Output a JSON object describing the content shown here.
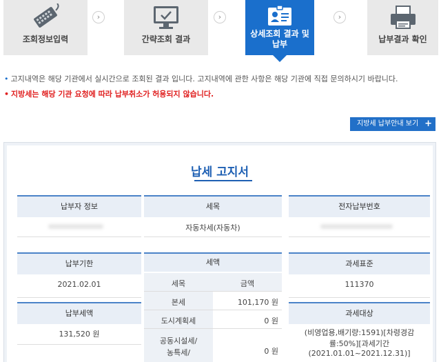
{
  "steps": [
    {
      "label": "조회정보입력",
      "icon": "keyboard-icon"
    },
    {
      "label": "간략조회 결과",
      "icon": "monitor-check-icon"
    },
    {
      "label": "상세조회 결과 및\n납부",
      "icon": "id-card-icon",
      "active": true
    },
    {
      "label": "납부결과 확인",
      "icon": "printer-icon"
    }
  ],
  "step_arrow": "›",
  "notices": {
    "info": "고지내역은 해당 기관에서 실시간으로 조회된 결과 입니다. 고지내역에 관한 사항은 해당 기관에 직접 문의하시기 바랍니다.",
    "warning": "지방세는 해당 기관 요청에 따라 납부취소가 허용되지 않습니다."
  },
  "guide_button": {
    "label": "지방세 납부안내 보기",
    "icon": "plus-icon"
  },
  "notice_doc": {
    "title": "납세 고지서",
    "headers": {
      "payer_info": "납부자 정보",
      "tax_item": "세목",
      "epay_no": "전자납부번호",
      "due_date": "납부기한",
      "tax_amount": "세액",
      "tax_base": "과세표준",
      "pay_amount": "납부세액",
      "tax_object": "과세대상"
    },
    "values": {
      "tax_item": "자동차세(자동차)",
      "due_date": "2021.02.01",
      "tax_base": "111370",
      "pay_amount": "131,520 원",
      "tax_object_line1": "(비영업용,배기량:1591)[차령경감",
      "tax_object_line2": "률:50%][과세기간(2021.01.01~2021.12.31)]"
    },
    "breakdown": {
      "col_item": "세목",
      "col_amount": "금액",
      "rows": [
        {
          "item": "본세",
          "amount": "101,170 원"
        },
        {
          "item": "도시계획세",
          "amount": "0 원"
        },
        {
          "item": "공동시설세/\n농특세/",
          "amount": "0 원"
        }
      ]
    }
  },
  "colors": {
    "accent": "#1a6fcc",
    "warning": "#e02020",
    "title": "#1d5fb3"
  }
}
